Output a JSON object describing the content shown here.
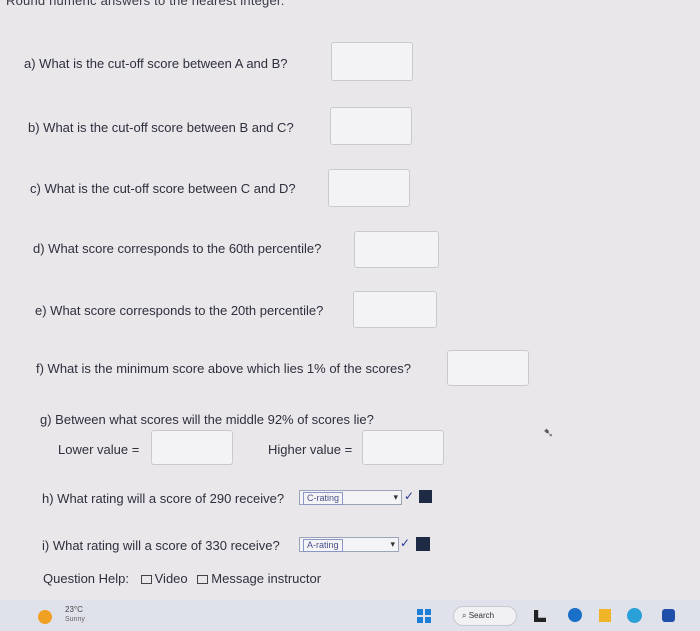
{
  "header": {
    "truncated_instruction": "Round numeric answers to the nearest integer."
  },
  "questions": [
    {
      "label": "a) What is the cut-off score between A and B?"
    },
    {
      "label": "b) What is the cut-off score between B and C?"
    },
    {
      "label": "c) What is the cut-off score between C and D?"
    },
    {
      "label": "d) What score corresponds to the 60th percentile?"
    },
    {
      "label": "e) What score corresponds to the 20th percentile?"
    },
    {
      "label": "f) What is the minimum score above which lies 1% of the scores?"
    }
  ],
  "question_g": {
    "label": "g) Between what scores will the middle 92% of scores lie?",
    "lower_label": "Lower value =",
    "higher_label": "Higher value ="
  },
  "question_h": {
    "label": "h) What rating will a score of 290 receive?",
    "selected": "C-rating"
  },
  "question_i": {
    "label": "i) What rating will a score of 330 receive?",
    "selected": "A-rating"
  },
  "help": {
    "label": "Question Help:",
    "video": "Video",
    "message": "Message instructor"
  },
  "taskbar": {
    "temp": "23°C",
    "weather": "Sunny",
    "search": "Search"
  },
  "colors": {
    "accent": "#2a3a9a",
    "checkbox": "#1f2a44"
  }
}
